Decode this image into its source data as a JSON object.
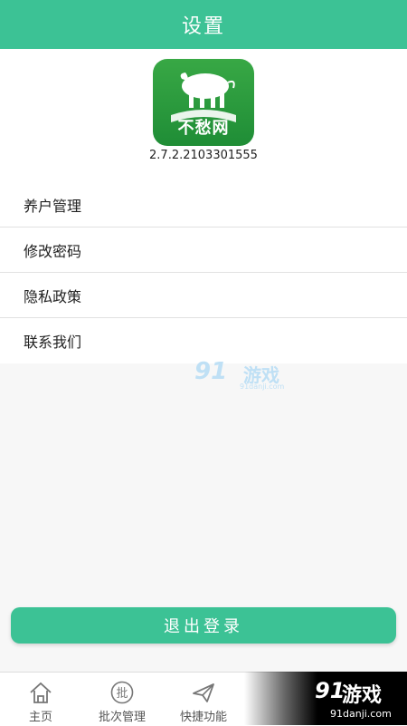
{
  "header": {
    "title": "设置"
  },
  "about": {
    "logo_text": "不愁网",
    "version": "2.7.2.2103301555"
  },
  "menu": {
    "items": [
      {
        "label": "养户管理"
      },
      {
        "label": "修改密码"
      },
      {
        "label": "隐私政策"
      },
      {
        "label": "联系我们"
      }
    ]
  },
  "watermark": {
    "brand_num": "91",
    "brand_cn": "游戏",
    "site": "91danji.com"
  },
  "logout": {
    "label": "退出登录"
  },
  "tabbar": {
    "tabs": [
      {
        "label": "主页",
        "icon": "home-icon"
      },
      {
        "label": "批次管理",
        "icon": "batch-icon",
        "glyph": "批"
      },
      {
        "label": "快捷功能",
        "icon": "paper-plane-icon"
      }
    ]
  },
  "colors": {
    "accent": "#3cc295",
    "logo_green": "#2a9a3e"
  }
}
